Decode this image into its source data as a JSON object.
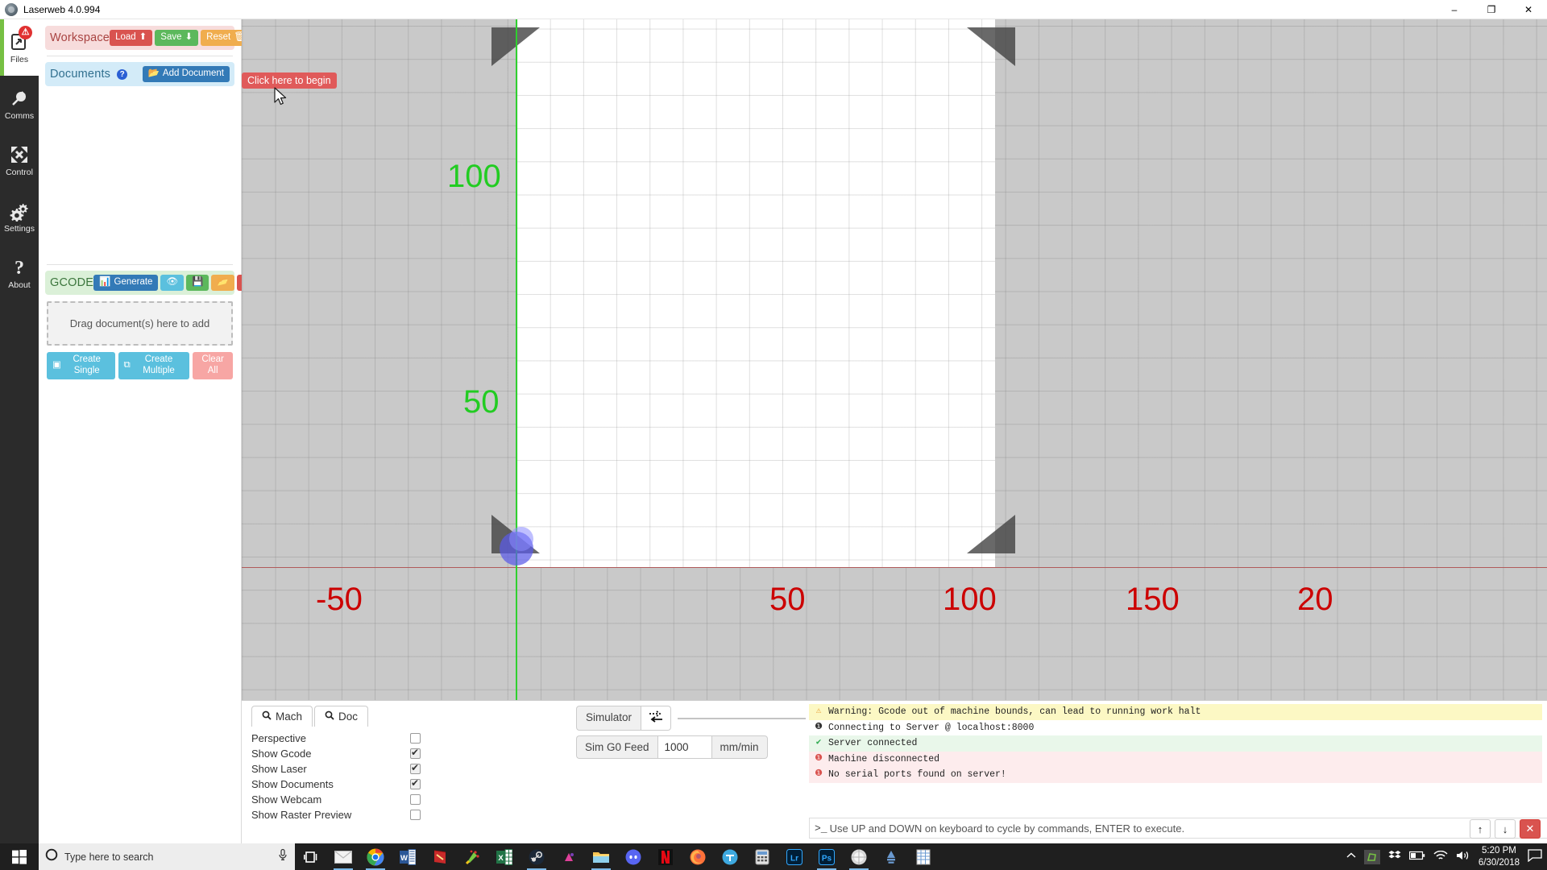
{
  "window": {
    "title": "Laserweb 4.0.994",
    "icon": "laserweb-logo-icon",
    "minimize": "–",
    "maximize": "❐",
    "close": "✕"
  },
  "rail": {
    "items": [
      {
        "label": "Files",
        "icon": "file-export-icon",
        "active": true,
        "badge": "⚠"
      },
      {
        "label": "Comms",
        "icon": "plug-icon",
        "active": false,
        "badge": ""
      },
      {
        "label": "Control",
        "icon": "arrows-move-icon",
        "active": false,
        "badge": ""
      },
      {
        "label": "Settings",
        "icon": "gears-icon",
        "active": false,
        "badge": ""
      },
      {
        "label": "About",
        "icon": "question-icon",
        "active": false,
        "badge": ""
      }
    ]
  },
  "workspace": {
    "title": "Workspace",
    "load_label": "Load",
    "save_label": "Save",
    "reset_label": "Reset"
  },
  "documents": {
    "title": "Documents",
    "help_icon": "question-circle-icon",
    "add_label": "Add Document"
  },
  "gcode": {
    "title": "GCODE",
    "generate_label": "Generate",
    "preview_icon": "eye-icon",
    "save_icon": "floppy-save-icon",
    "open_icon": "folder-open-icon",
    "delete_icon": "trash-icon",
    "dropzone_text": "Drag document(s) here to add",
    "create_single_label": "Create Single",
    "create_multiple_label": "Create Multiple",
    "clear_all_label": "Clear All"
  },
  "callout": {
    "text": "Click here to begin"
  },
  "viewport": {
    "y_labels": [
      "100",
      "50"
    ],
    "x_labels": [
      "-50",
      "50",
      "100",
      "150",
      "20"
    ],
    "axis_x_color": "#b05a5a",
    "axis_y_color": "#2fd02f",
    "y_label_color": "#22cc22",
    "x_label_color": "#cc0000",
    "bed_color": "#ffffff",
    "background_color": "#c9c9c9"
  },
  "viewtabs": {
    "mach": "Mach",
    "doc": "Doc",
    "search_icon": "magnifier-icon"
  },
  "viewoptions": [
    {
      "label": "Perspective",
      "checked": false
    },
    {
      "label": "Show Gcode",
      "checked": true
    },
    {
      "label": "Show Laser",
      "checked": true
    },
    {
      "label": "Show Documents",
      "checked": true
    },
    {
      "label": "Show Webcam",
      "checked": false
    },
    {
      "label": "Show Raster Preview",
      "checked": false
    }
  ],
  "simulator": {
    "label": "Simulator",
    "toggle_icon": "exchange-arrows-icon",
    "feed_label": "Sim G0 Feed",
    "feed_value": "1000",
    "feed_unit": "mm/min"
  },
  "console": {
    "lines": [
      {
        "level": "warn",
        "icon": "warning-triangle-icon",
        "text": "Warning: Gcode out of machine bounds, can lead to running work halt"
      },
      {
        "level": "info",
        "icon": "info-circle-icon",
        "text": "Connecting to Server @ localhost:8000"
      },
      {
        "level": "ok",
        "icon": "check-circle-icon",
        "text": "Server connected"
      },
      {
        "level": "err",
        "icon": "error-circle-icon",
        "text": "Machine disconnected"
      },
      {
        "level": "err",
        "icon": "error-circle-icon",
        "text": "No serial ports found on server!"
      }
    ],
    "prompt": ">_",
    "hint": "Use UP and DOWN on keyboard to cycle by commands, ENTER to execute.",
    "scroll_up_icon": "arrow-up-icon",
    "scroll_down_icon": "arrow-down-icon",
    "clear_icon": "close-x-icon"
  },
  "taskbar": {
    "start_icon": "windows-start-icon",
    "search_icon": "circle-cortana-icon",
    "search_placeholder": "Type here to search",
    "mic_icon": "microphone-icon",
    "taskview_icon": "task-view-icon",
    "apps": [
      {
        "name": "mail-icon",
        "open": true
      },
      {
        "name": "chrome-icon",
        "open": true
      },
      {
        "name": "word-icon",
        "open": false
      },
      {
        "name": "notebook-icon",
        "open": false
      },
      {
        "name": "inkscape-icon",
        "open": false
      },
      {
        "name": "excel-icon",
        "open": false
      },
      {
        "name": "steam-icon",
        "open": true
      },
      {
        "name": "pink-app-icon",
        "open": false
      },
      {
        "name": "file-explorer-icon",
        "open": true
      },
      {
        "name": "discord-icon",
        "open": false
      },
      {
        "name": "netflix-icon",
        "open": false
      },
      {
        "name": "firefox-icon",
        "open": false
      },
      {
        "name": "teams-icon",
        "open": false
      },
      {
        "name": "calculator-icon",
        "open": false
      },
      {
        "name": "lightroom-icon",
        "open": false
      },
      {
        "name": "photoshop-icon",
        "open": true
      },
      {
        "name": "browser-icon",
        "open": true
      },
      {
        "name": "utorrent-icon",
        "open": false
      },
      {
        "name": "sheets-icon",
        "open": false
      }
    ],
    "tray": {
      "expand_icon": "chevron-up-icon",
      "icons": [
        "laserweb-tray-icon",
        "dropbox-icon",
        "battery-icon",
        "wifi-icon",
        "volume-icon"
      ],
      "time": "5:20 PM",
      "date": "6/30/2018",
      "notification_icon": "action-center-icon"
    }
  }
}
